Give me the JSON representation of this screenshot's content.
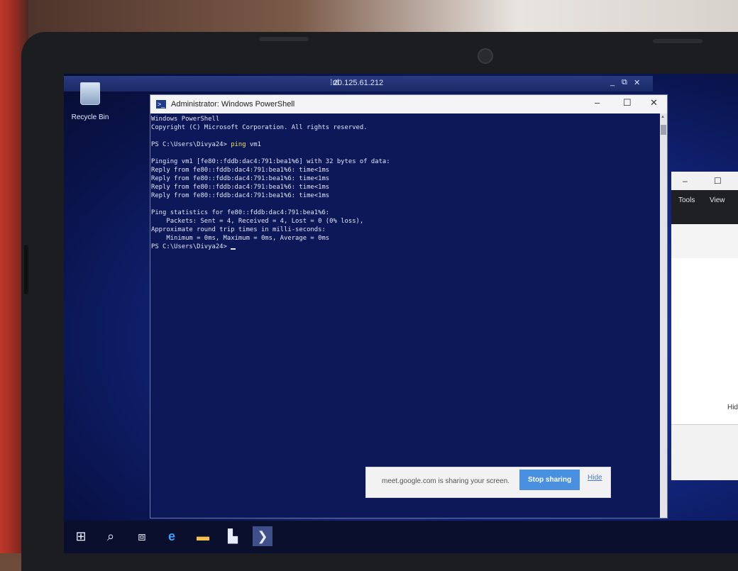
{
  "desktop": {
    "recycle_bin_label": "Recycle Bin"
  },
  "remote_bar": {
    "ip": "20.125.61.212",
    "signal_icon": "signal-bars-icon"
  },
  "powershell": {
    "title": "Administrator: Windows PowerShell",
    "lines": {
      "l1": "Windows PowerShell",
      "l2": "Copyright (C) Microsoft Corporation. All rights reserved.",
      "l4_prompt": "PS C:\\Users\\Divya24> ",
      "l4_cmd": "ping",
      "l4_arg": " vm1",
      "l6": "Pinging vm1 [fe80::fddb:dac4:791:bea1%6] with 32 bytes of data:",
      "l7": "Reply from fe80::fddb:dac4:791:bea1%6: time<1ms",
      "l8": "Reply from fe80::fddb:dac4:791:bea1%6: time<1ms",
      "l9": "Reply from fe80::fddb:dac4:791:bea1%6: time<1ms",
      "l10": "Reply from fe80::fddb:dac4:791:bea1%6: time<1ms",
      "l12": "Ping statistics for fe80::fddb:dac4:791:bea1%6:",
      "l13": "    Packets: Sent = 4, Received = 4, Lost = 0 (0% loss),",
      "l14": "Approximate round trip times in milli-seconds:",
      "l15": "    Minimum = 0ms, Maximum = 0ms, Average = 0ms",
      "l16": "PS C:\\Users\\Divya24> "
    }
  },
  "background_window": {
    "menu": {
      "tools": "Tools",
      "view": "View"
    },
    "hide_label": "Hid"
  },
  "share_bar": {
    "message": "meet.google.com is sharing your screen.",
    "stop_label": "Stop sharing",
    "hide_label": "Hide"
  },
  "colors": {
    "ps_background": "#0c1858",
    "ps_text": "#e2e6f6",
    "command_highlight": "#f1e35a",
    "share_button": "#4a90e0"
  }
}
